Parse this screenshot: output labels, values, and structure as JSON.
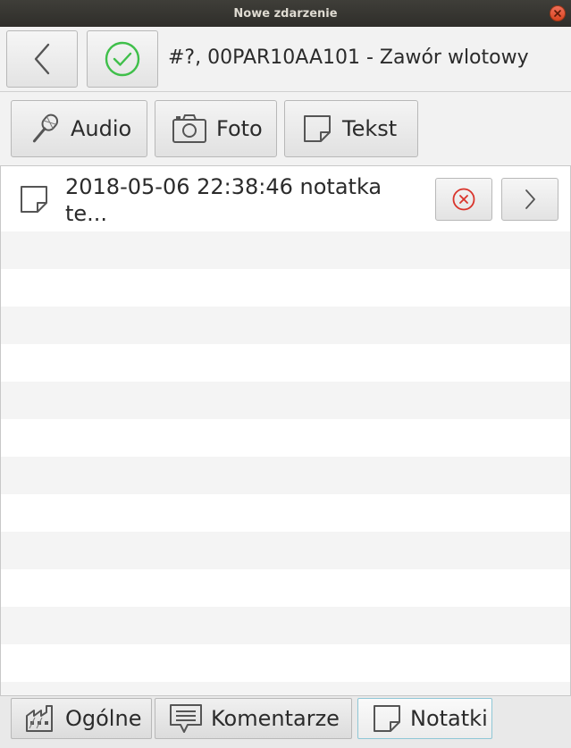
{
  "window": {
    "title": "Nowe zdarzenie"
  },
  "header": {
    "title": "#?, 00PAR10AA101 - Zawór wlotowy",
    "back_icon": "chevron-left-icon",
    "confirm_icon": "check-circle-icon",
    "confirm_color": "#3fbf4a"
  },
  "toolbar": {
    "items": [
      {
        "label": "Audio",
        "icon": "microphone-icon"
      },
      {
        "label": "Foto",
        "icon": "camera-icon"
      },
      {
        "label": "Tekst",
        "icon": "note-icon"
      }
    ]
  },
  "notes": [
    {
      "text": "2018-05-06 22:38:46 notatka te...",
      "icon": "note-icon",
      "delete_icon": "delete-circle-icon",
      "delete_color": "#d9342b",
      "open_icon": "chevron-right-icon"
    }
  ],
  "bottom_tabs": [
    {
      "label": "Ogólne",
      "icon": "factory-icon",
      "active": false
    },
    {
      "label": "Komentarze",
      "icon": "comment-icon",
      "active": false
    },
    {
      "label": "Notatki",
      "icon": "note-icon",
      "active": true
    }
  ],
  "colors": {
    "close_button": "#e0522c",
    "active_tab_border": "#8fc7d6"
  }
}
